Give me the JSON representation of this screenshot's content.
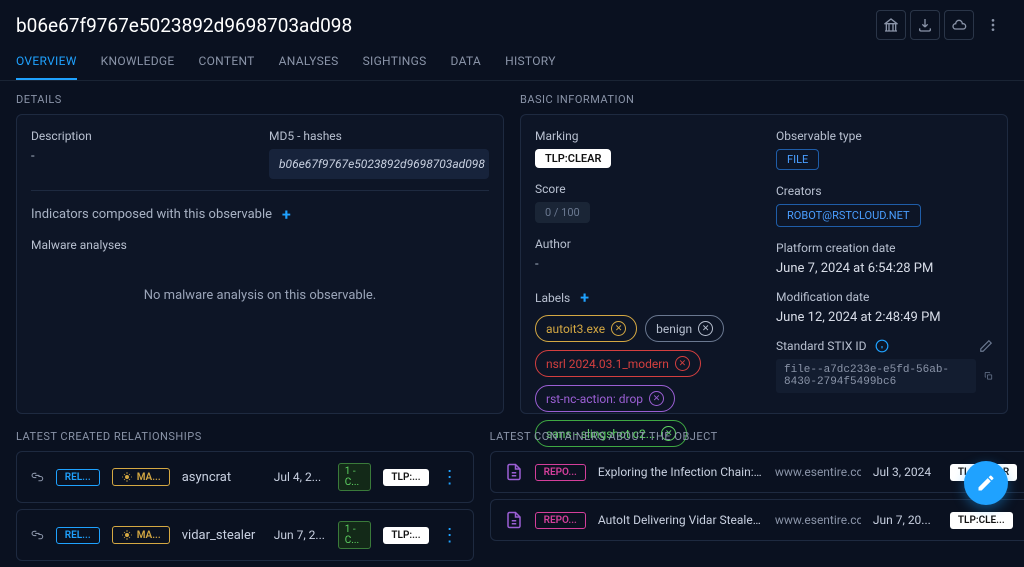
{
  "header": {
    "title": "b06e67f9767e5023892d9698703ad098"
  },
  "tabs": [
    "OVERVIEW",
    "KNOWLEDGE",
    "CONTENT",
    "ANALYSES",
    "SIGHTINGS",
    "DATA",
    "HISTORY"
  ],
  "sections": {
    "details": "DETAILS",
    "basic": "BASIC INFORMATION",
    "relationships": "LATEST CREATED RELATIONSHIPS",
    "containers": "LATEST CONTAINERS ABOUT THE OBJECT"
  },
  "details": {
    "description_label": "Description",
    "description_value": "-",
    "md5_label": "MD5 - hashes",
    "md5_value": "b06e67f9767e5023892d9698703ad098",
    "indicators_label": "Indicators composed with this observable",
    "malware_label": "Malware analyses",
    "no_malware": "No malware analysis on this observable."
  },
  "basic": {
    "marking_label": "Marking",
    "marking_value": "TLP:CLEAR",
    "score_label": "Score",
    "score_value": "0 / 100",
    "author_label": "Author",
    "author_value": "-",
    "labels_label": "Labels",
    "labels": [
      {
        "text": "autoit3.exe",
        "cls": "lc-orange"
      },
      {
        "text": "benign",
        "cls": "lc-gray"
      },
      {
        "text": "nsrl 2024.03.1_modern",
        "cls": "lc-red"
      },
      {
        "text": "rst-nc-action: drop",
        "cls": "lc-purple"
      },
      {
        "text": "sans - slingshot c2...",
        "cls": "lc-green"
      }
    ],
    "type_label": "Observable type",
    "type_value": "FILE",
    "creators_label": "Creators",
    "creators_value": "ROBOT@RSTCLOUD.NET",
    "created_label": "Platform creation date",
    "created_value": "June 7, 2024 at 6:54:28 PM",
    "modified_label": "Modification date",
    "modified_value": "June 12, 2024 at 2:48:49 PM",
    "stix_label": "Standard STIX ID",
    "stix_value": "file--a7dc233e-e5fd-56ab-8430-2794f5499bc6"
  },
  "relationships": [
    {
      "rel": "REL...",
      "type": "MA...",
      "name": "asyncrat",
      "date": "Jul 4, 2...",
      "conf": "1 - C...",
      "tlp": "TLP:..."
    },
    {
      "rel": "REL...",
      "type": "MA...",
      "name": "vidar_stealer",
      "date": "Jun 7, 2...",
      "conf": "1 - C...",
      "tlp": "TLP:..."
    }
  ],
  "containers": [
    {
      "badge": "REPO...",
      "title": "Exploring the Infection Chain: Screen...",
      "src": "www.esentire.com",
      "date": "Jul 3, 2024",
      "tlp": "TLP:CLEAR"
    },
    {
      "badge": "REPO...",
      "title": "AutoIt Delivering Vidar Stealer Via Dr...",
      "src": "www.esentire.com",
      "date": "Jun 7, 20...",
      "tlp": "TLP:CLE..."
    }
  ]
}
